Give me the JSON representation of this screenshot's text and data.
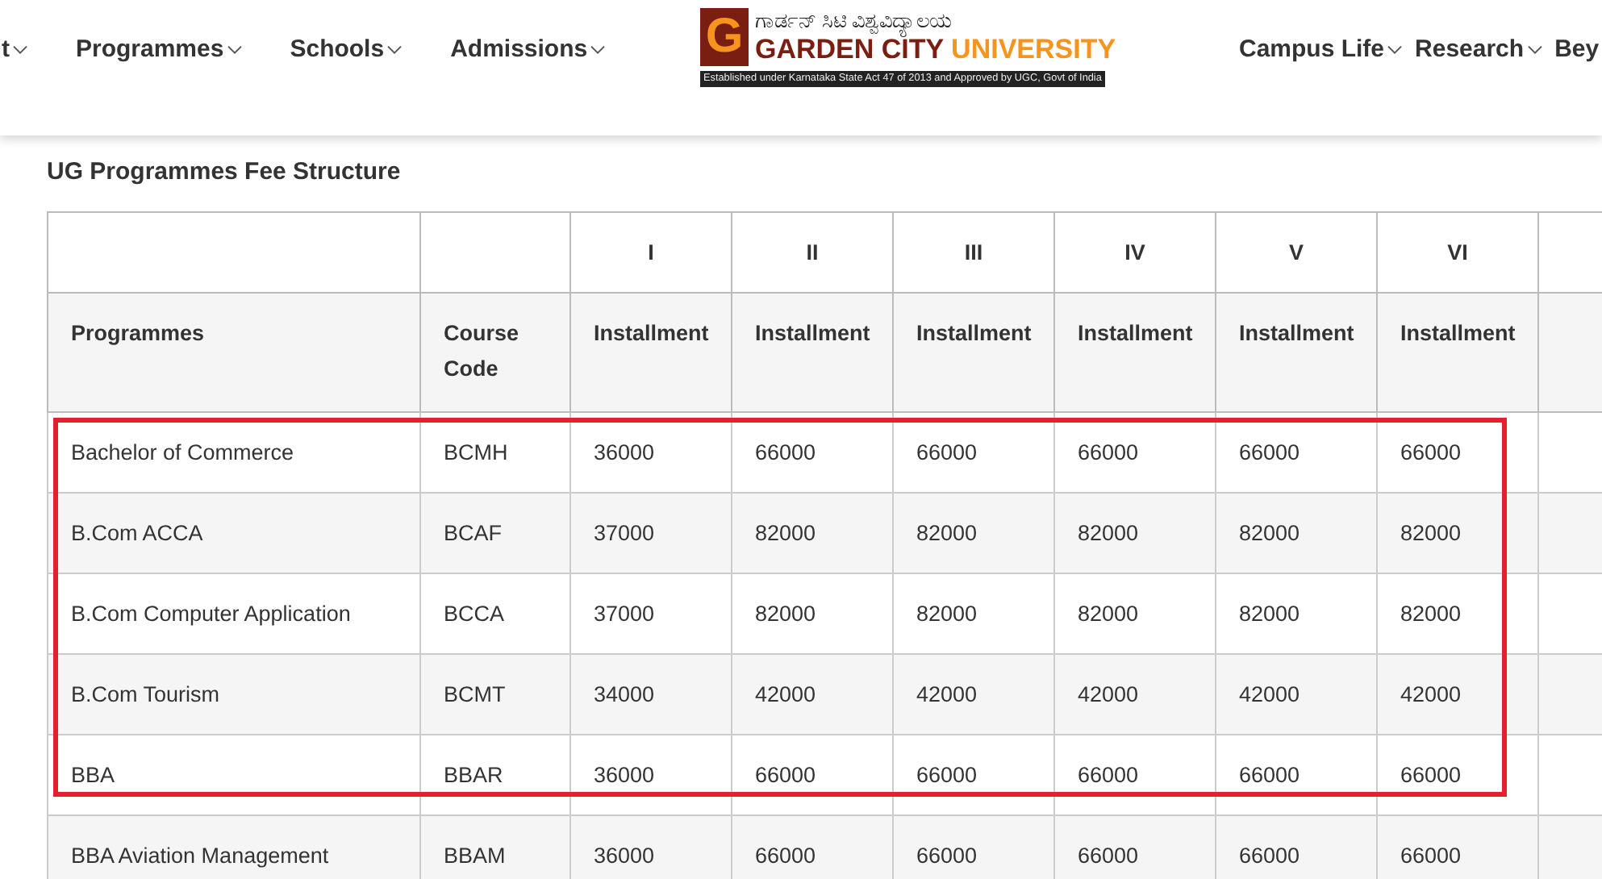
{
  "nav": {
    "left_items": [
      {
        "label": "t"
      },
      {
        "label": "Programmes"
      },
      {
        "label": "Schools"
      },
      {
        "label": "Admissions"
      }
    ],
    "logo": {
      "letter": "G",
      "native_name": "ಗಾರ್ಡನ್ ಸಿಟಿ ವಿಶ್ವವಿದ್ಯಾಲಯ",
      "name_part_1": "GARDEN CITY",
      "name_part_2": "UNIVERSITY",
      "tagline": "Established under Karnataka State Act 47 of 2013 and Approved by UGC, Govt of India"
    },
    "right_items": [
      {
        "label": "Campus Life"
      },
      {
        "label": "Research"
      },
      {
        "label": "Bey"
      }
    ]
  },
  "section_title": "UG Programmes Fee Structure",
  "table": {
    "top_header": [
      "I",
      "II",
      "III",
      "IV",
      "V",
      "VI"
    ],
    "columns": [
      "Programmes",
      "Course Code",
      "Installment",
      "Installment",
      "Installment",
      "Installment",
      "Installment",
      "Installment"
    ],
    "rows": [
      {
        "cells": [
          "Bachelor of Commerce",
          "BCMH",
          "36000",
          "66000",
          "66000",
          "66000",
          "66000",
          "66000"
        ],
        "highlighted": true
      },
      {
        "cells": [
          "B.Com ACCA",
          "BCAF",
          "37000",
          "82000",
          "82000",
          "82000",
          "82000",
          "82000"
        ],
        "highlighted": true
      },
      {
        "cells": [
          "B.Com Computer Application",
          "BCCA",
          "37000",
          "82000",
          "82000",
          "82000",
          "82000",
          "82000"
        ],
        "highlighted": true
      },
      {
        "cells": [
          "B.Com Tourism",
          "BCMT",
          "34000",
          "42000",
          "42000",
          "42000",
          "42000",
          "42000"
        ],
        "highlighted": true
      },
      {
        "cells": [
          "BBA",
          "BBAR",
          "36000",
          "66000",
          "66000",
          "66000",
          "66000",
          "66000"
        ],
        "highlighted": true
      },
      {
        "cells": [
          "BBA Aviation Management",
          "BBAM",
          "36000",
          "66000",
          "66000",
          "66000",
          "66000",
          "66000"
        ],
        "highlighted": false
      }
    ]
  }
}
